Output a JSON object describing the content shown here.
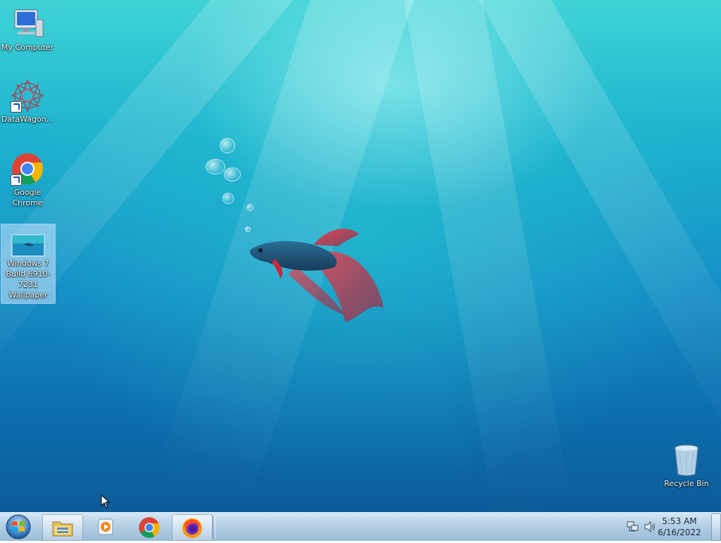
{
  "desktop": {
    "icons": [
      {
        "label": "My Computer"
      },
      {
        "label": "DataWagon..."
      },
      {
        "label": "Google Chrome"
      },
      {
        "label": "Windows 7 Build 6910-7231 Wallpaper"
      }
    ],
    "recycle_bin": {
      "label": "Recycle Bin"
    }
  },
  "taskbar": {
    "start": {
      "icon": "windows-orb-icon"
    },
    "items": [
      {
        "icon": "file-explorer-icon"
      },
      {
        "icon": "media-player-icon"
      },
      {
        "icon": "chrome-icon"
      },
      {
        "icon": "firefox-icon"
      }
    ],
    "tray": {
      "icons": [
        "network-icon",
        "volume-icon"
      ],
      "time": "5:53 AM",
      "date": "6/16/2022"
    }
  },
  "colors": {
    "wallpaper_top": "#3fd3d6",
    "wallpaper_bottom": "#0b5c98",
    "fish_body": "#1d4e72",
    "fish_fins": "#c8283a"
  }
}
